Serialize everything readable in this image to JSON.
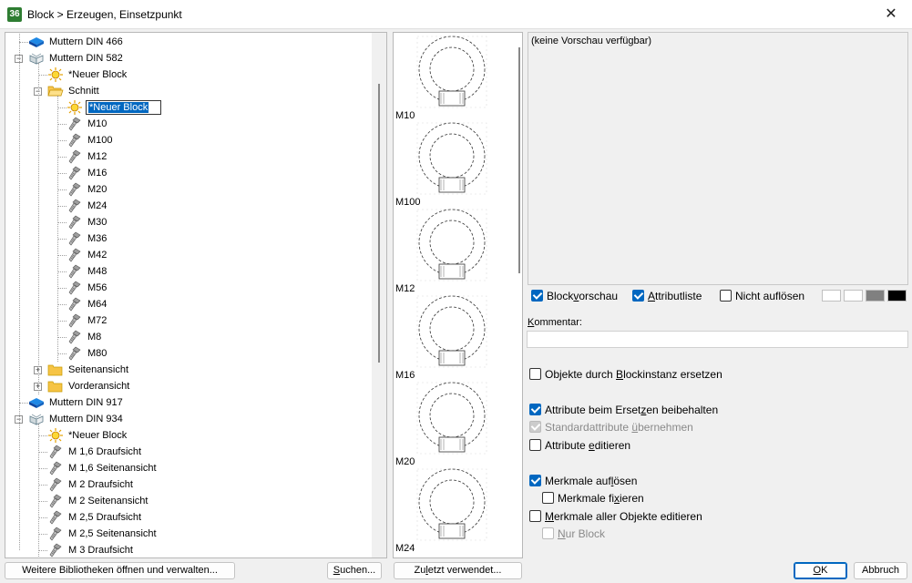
{
  "window": {
    "title": "Block > Erzeugen, Einsetzpunkt",
    "app_icon_text": "36",
    "close_glyph": "✕"
  },
  "tree": {
    "items": [
      {
        "label": "Muttern DIN 466",
        "icon": "book-icon",
        "depth": 0,
        "expander": ""
      },
      {
        "label": "Muttern DIN 582",
        "icon": "open-book-icon",
        "depth": 0,
        "expander": "−"
      },
      {
        "label": "*Neuer Block",
        "icon": "new-block-icon",
        "depth": 1,
        "expander": ""
      },
      {
        "label": "Schnitt",
        "icon": "open-folder-icon",
        "depth": 1,
        "expander": "−"
      },
      {
        "label": "*Neuer Block",
        "icon": "new-block-icon",
        "depth": 2,
        "expander": "",
        "editing": true
      },
      {
        "label": "M10",
        "icon": "bolt-icon",
        "depth": 2,
        "expander": ""
      },
      {
        "label": "M100",
        "icon": "bolt-icon",
        "depth": 2,
        "expander": ""
      },
      {
        "label": "M12",
        "icon": "bolt-icon",
        "depth": 2,
        "expander": ""
      },
      {
        "label": "M16",
        "icon": "bolt-icon",
        "depth": 2,
        "expander": ""
      },
      {
        "label": "M20",
        "icon": "bolt-icon",
        "depth": 2,
        "expander": ""
      },
      {
        "label": "M24",
        "icon": "bolt-icon",
        "depth": 2,
        "expander": ""
      },
      {
        "label": "M30",
        "icon": "bolt-icon",
        "depth": 2,
        "expander": ""
      },
      {
        "label": "M36",
        "icon": "bolt-icon",
        "depth": 2,
        "expander": ""
      },
      {
        "label": "M42",
        "icon": "bolt-icon",
        "depth": 2,
        "expander": ""
      },
      {
        "label": "M48",
        "icon": "bolt-icon",
        "depth": 2,
        "expander": ""
      },
      {
        "label": "M56",
        "icon": "bolt-icon",
        "depth": 2,
        "expander": ""
      },
      {
        "label": "M64",
        "icon": "bolt-icon",
        "depth": 2,
        "expander": ""
      },
      {
        "label": "M72",
        "icon": "bolt-icon",
        "depth": 2,
        "expander": ""
      },
      {
        "label": "M8",
        "icon": "bolt-icon",
        "depth": 2,
        "expander": ""
      },
      {
        "label": "M80",
        "icon": "bolt-icon",
        "depth": 2,
        "expander": ""
      },
      {
        "label": "Seitenansicht",
        "icon": "folder-icon",
        "depth": 1,
        "expander": "+"
      },
      {
        "label": "Vorderansicht",
        "icon": "folder-icon",
        "depth": 1,
        "expander": "+"
      },
      {
        "label": "Muttern DIN 917",
        "icon": "book-icon",
        "depth": 0,
        "expander": ""
      },
      {
        "label": "Muttern DIN 934",
        "icon": "open-book-icon",
        "depth": 0,
        "expander": "−"
      },
      {
        "label": "*Neuer Block",
        "icon": "new-block-icon",
        "depth": 1,
        "expander": ""
      },
      {
        "label": "M  1,6 Draufsicht",
        "icon": "bolt-icon",
        "depth": 1,
        "expander": ""
      },
      {
        "label": "M  1,6 Seitenansicht",
        "icon": "bolt-icon",
        "depth": 1,
        "expander": ""
      },
      {
        "label": "M  2 Draufsicht",
        "icon": "bolt-icon",
        "depth": 1,
        "expander": ""
      },
      {
        "label": "M  2 Seitenansicht",
        "icon": "bolt-icon",
        "depth": 1,
        "expander": ""
      },
      {
        "label": "M  2,5 Draufsicht",
        "icon": "bolt-icon",
        "depth": 1,
        "expander": ""
      },
      {
        "label": "M  2,5 Seitenansicht",
        "icon": "bolt-icon",
        "depth": 1,
        "expander": ""
      },
      {
        "label": "M  3 Draufsicht",
        "icon": "bolt-icon",
        "depth": 1,
        "expander": ""
      }
    ]
  },
  "thumbnails": [
    "M10",
    "M100",
    "M12",
    "M16",
    "M20",
    "M24"
  ],
  "preview": {
    "text": "(keine Vorschau verfügbar)"
  },
  "options": {
    "blockvorschau": {
      "pre": "Block",
      "u": "v",
      "post": "orschau",
      "checked": true
    },
    "attributliste": {
      "pre": "",
      "u": "A",
      "post": "ttributliste",
      "checked": true
    },
    "nicht_aufloesen": {
      "pre": "Nicht auflösen",
      "u": "",
      "post": "",
      "checked": false
    }
  },
  "swatch_colors": [
    "#ffffff",
    "#ffffff",
    "#808080",
    "#000000"
  ],
  "comment": {
    "label_u": "K",
    "label_rest": "ommentar:",
    "value": ""
  },
  "checks": [
    {
      "pre": "Objekte durch ",
      "u": "B",
      "post": "lockinstanz ersetzen",
      "checked": false,
      "disabled": false
    },
    {
      "pre": "Attribute beim Erset",
      "u": "z",
      "post": "en beibehalten",
      "checked": true,
      "disabled": false
    },
    {
      "pre": "Standardattribute ",
      "u": "ü",
      "post": "bernehmen",
      "checked": true,
      "disabled": true
    },
    {
      "pre": "Attribute ",
      "u": "e",
      "post": "ditieren",
      "checked": false,
      "disabled": false
    },
    {
      "pre": "Merkmale auf",
      "u": "l",
      "post": "ösen",
      "checked": true,
      "disabled": false
    },
    {
      "pre": "Merkmale fi",
      "u": "x",
      "post": "ieren",
      "checked": false,
      "disabled": false
    },
    {
      "pre": "",
      "u": "M",
      "post": "erkmale aller Objekte editieren",
      "checked": false,
      "disabled": false
    },
    {
      "pre": "",
      "u": "N",
      "post": "ur Block",
      "checked": false,
      "disabled": true
    }
  ],
  "buttons": {
    "weitere": "Weitere Bibliotheken öffnen und verwalten...",
    "suchen_u": "S",
    "suchen_rest": "uchen...",
    "zuletzt_pre": "Zu",
    "zuletzt_u": "l",
    "zuletzt_post": "etzt verwendet...",
    "ok_u": "O",
    "ok_rest": "K",
    "abbruch": "Abbruch"
  }
}
